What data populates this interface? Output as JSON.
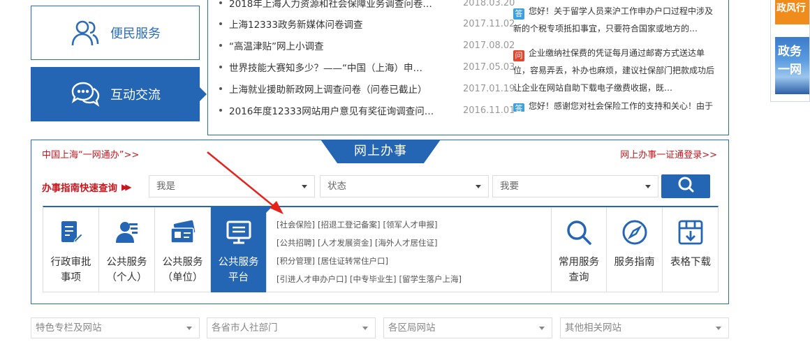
{
  "tiles": {
    "bianmin": "便民服务",
    "hudong": "互动交流"
  },
  "news": [
    {
      "title": "2018年上海人力资源和社会保障业务调查问卷…",
      "date": "2018.03.20"
    },
    {
      "title": "上海12333政务新媒体问卷调查",
      "date": "2017.11.02"
    },
    {
      "title": "“高温津贴”网上小调查",
      "date": "2017.08.02"
    },
    {
      "title": "世界技能大赛知多少？——“中国（上海）申…",
      "date": "2017.05.03"
    },
    {
      "title": "上海就业援助新政网上调查问卷（问卷已截止）",
      "date": "2017.01.19"
    },
    {
      "title": "2016年度12333网站用户意见有奖征询调查问…",
      "date": "2016.11.01"
    }
  ],
  "qa": [
    {
      "badge": "答",
      "line1": "您好！关于留学人员来沪工作申办户口过程中涉及",
      "line2": "新的个税专项抵扣事宜，只要符合国家或地方的…"
    },
    {
      "badge": "问",
      "line1": "企业缴纳社保费的凭证每月通过邮寄方式送达单",
      "line2": "位，容易弄丢，补办也麻烦，建议社保部门把款成功后",
      "line3": "让企业在网站自助下载电子缴费收据，既…"
    },
    {
      "badge": "答",
      "line1": "您好！感谢您对社会保险工作的支持和关心！由于"
    }
  ],
  "online": {
    "left_link": "中国上海“一网通办”>>",
    "title": "网上办事",
    "right_link": "网上办事一证通登录>>",
    "quick_label": "办事指南快速查询",
    "selects": [
      "我是",
      "状态",
      "我要"
    ],
    "services": [
      {
        "line1": "行政审批",
        "line2": "事项"
      },
      {
        "line1": "公共服务",
        "line2": "（个人）"
      },
      {
        "line1": "公共服务",
        "line2": "（单位）"
      },
      {
        "line1": "公共服务",
        "line2": "平台"
      },
      {
        "line1": "常用服务",
        "line2": "查询"
      },
      {
        "line1": "服务指南",
        "line2": ""
      },
      {
        "line1": "表格下载",
        "line2": ""
      }
    ],
    "links": [
      [
        "[社会保险]",
        "[招退工登记备案]",
        "[领军人才申报]"
      ],
      [
        "[公共招聘]",
        "[人才发展资金]",
        "[海外人才居住证]"
      ],
      [
        "[积分管理]",
        "[居住证转常住户口]"
      ],
      [
        "[引进人才申办户口]",
        "[中专毕业生]",
        "[留学生落户上海]"
      ]
    ]
  },
  "bottom_selects": [
    "特色专栏及网站",
    "各省市人社部门",
    "各区局网站",
    "其他相关网站"
  ],
  "banner": {
    "top_text": "政风行",
    "img_line1": "政务",
    "img_line2": "一网"
  },
  "colors": {
    "primary": "#2466b3",
    "accent_red": "#c8161d",
    "border": "#dddddd"
  }
}
